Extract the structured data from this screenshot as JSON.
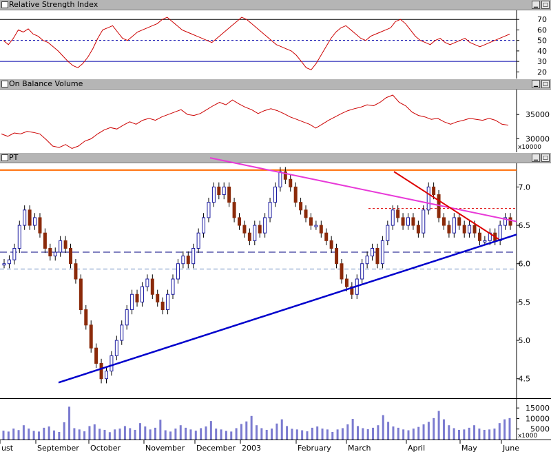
{
  "panes": {
    "rsi": {
      "title": "Relative Strength Index",
      "ticks": [
        "70",
        "60",
        "50",
        "40",
        "30",
        "20"
      ]
    },
    "obv": {
      "title": "On Balance Volume",
      "ticks": [
        "35000",
        "30000"
      ],
      "unit": "x10000"
    },
    "price": {
      "title": "PT",
      "ticks": [
        "7.0",
        "6.5",
        "6.0",
        "5.5",
        "5.0",
        "4.5"
      ]
    },
    "volume": {
      "ticks": [
        "15000",
        "10000",
        "5000"
      ],
      "unit": "x1000"
    }
  },
  "xaxis": {
    "labels": [
      "ust",
      "September",
      "October",
      "November",
      "December",
      "2003",
      "February",
      "March",
      "April",
      "May",
      "June"
    ]
  },
  "colors": {
    "titlebar": "#b5b5b5",
    "rsi_line": "#cc0000",
    "trend_blue": "#0000cc",
    "trend_magenta": "#e83ad8",
    "trend_red": "#dd0000",
    "support_orange": "#ff6a00",
    "candle_up": "#1a1aa0",
    "candle_down": "#8b2a0a",
    "volume_bar": "#7b7bd0"
  },
  "chart_data": [
    {
      "type": "line",
      "title": "Relative Strength Index",
      "ylim": [
        15,
        78
      ],
      "reference_lines": [
        70,
        50,
        30
      ],
      "series": [
        {
          "values": [
            50,
            46,
            52,
            60,
            58,
            61,
            56,
            54,
            50,
            48,
            44,
            40,
            35,
            30,
            26,
            24,
            28,
            34,
            42,
            52,
            60,
            62,
            64,
            58,
            52,
            50,
            54,
            58,
            60,
            62,
            64,
            66,
            70,
            72,
            68,
            64,
            60,
            58,
            56,
            54,
            52,
            50,
            48,
            52,
            56,
            60,
            64,
            68,
            72,
            70,
            66,
            62,
            58,
            54,
            50,
            46,
            44,
            42,
            40,
            36,
            30,
            24,
            22,
            28,
            36,
            44,
            52,
            58,
            62,
            64,
            60,
            56,
            52,
            50,
            54,
            56,
            58,
            60,
            62,
            68,
            70,
            66,
            60,
            54,
            50,
            48,
            46,
            50,
            52,
            48,
            46,
            48,
            50,
            52,
            48,
            46,
            44,
            46,
            48,
            50,
            52,
            54,
            56
          ]
        }
      ]
    },
    {
      "type": "line",
      "title": "On Balance Volume",
      "ylim": [
        27500,
        40000
      ],
      "series": [
        {
          "values": [
            31000,
            30500,
            31200,
            31000,
            31500,
            31300,
            31000,
            29800,
            28500,
            28200,
            28800,
            28000,
            28500,
            29500,
            30000,
            31000,
            31800,
            32300,
            32000,
            32800,
            33500,
            33000,
            33800,
            34200,
            33800,
            34500,
            35000,
            35500,
            36000,
            35000,
            34800,
            35200,
            36000,
            36800,
            37500,
            37000,
            38000,
            37200,
            36500,
            36000,
            35200,
            35800,
            36200,
            35800,
            35200,
            34500,
            34000,
            33500,
            33000,
            32200,
            33000,
            33800,
            34500,
            35200,
            35800,
            36200,
            36500,
            37000,
            36800,
            37500,
            38500,
            39000,
            37500,
            36800,
            35500,
            34800,
            34500,
            34000,
            34200,
            33500,
            33000,
            33500,
            33800,
            34200,
            34000,
            33800,
            34200,
            33800,
            33000,
            32800
          ]
        }
      ]
    },
    {
      "type": "line",
      "title": "PT",
      "ylim": [
        4.3,
        7.3
      ],
      "series": [
        {
          "values": [
            6.0,
            6.05,
            6.2,
            6.5,
            6.7,
            6.5,
            6.6,
            6.4,
            6.2,
            6.1,
            6.15,
            6.3,
            6.2,
            6.0,
            5.8,
            5.4,
            5.2,
            4.9,
            4.7,
            4.5,
            4.6,
            4.8,
            5.0,
            5.2,
            5.4,
            5.6,
            5.5,
            5.7,
            5.8,
            5.6,
            5.5,
            5.4,
            5.6,
            5.8,
            6.0,
            6.1,
            6.0,
            6.2,
            6.4,
            6.6,
            6.8,
            7.0,
            6.9,
            7.0,
            6.8,
            6.6,
            6.5,
            6.4,
            6.3,
            6.5,
            6.4,
            6.6,
            6.8,
            7.0,
            7.2,
            7.1,
            7.0,
            6.8,
            6.7,
            6.6,
            6.5,
            6.5,
            6.4,
            6.3,
            6.2,
            6.0,
            5.8,
            5.7,
            5.6,
            5.8,
            6.0,
            6.1,
            6.2,
            6.0,
            6.3,
            6.5,
            6.7,
            6.6,
            6.5,
            6.6,
            6.5,
            6.4,
            6.7,
            7.0,
            6.9,
            6.6,
            6.5,
            6.4,
            6.6,
            6.5,
            6.4,
            6.5,
            6.4,
            6.3,
            6.3,
            6.4,
            6.3,
            6.5,
            6.6,
            6.5
          ]
        }
      ]
    },
    {
      "type": "bar",
      "title": "",
      "ylim": [
        0,
        18000
      ],
      "series": [
        {
          "values": [
            4200,
            3800,
            5200,
            4500,
            6800,
            5200,
            4100,
            3800,
            5600,
            6200,
            4300,
            3600,
            8200,
            15600,
            5400,
            4800,
            3900,
            6400,
            7200,
            5100,
            4600,
            3500,
            4800,
            5200,
            6400,
            5400,
            4600,
            7800,
            6200,
            4800,
            5600,
            9400,
            4400,
            3800,
            5200,
            6800,
            5600,
            4800,
            4200,
            5400,
            6200,
            8800,
            5200,
            4800,
            4100,
            3800,
            5400,
            7400,
            8600,
            11200,
            6800,
            5400,
            4600,
            5200,
            7600,
            9600,
            6400,
            5100,
            4800,
            4400,
            3900,
            5600,
            6200,
            5200,
            4800,
            3600,
            4800,
            5400,
            7200,
            9800,
            6400,
            5400,
            4900,
            5600,
            6800,
            11600,
            8400,
            6200,
            5600,
            4800,
            4400,
            5200,
            6000,
            7200,
            8400,
            10200,
            13600,
            9600,
            6800,
            5400,
            4600,
            4800,
            5600,
            6800,
            5200,
            4600,
            4800,
            5200,
            7800,
            9600,
            10200
          ]
        }
      ]
    }
  ]
}
